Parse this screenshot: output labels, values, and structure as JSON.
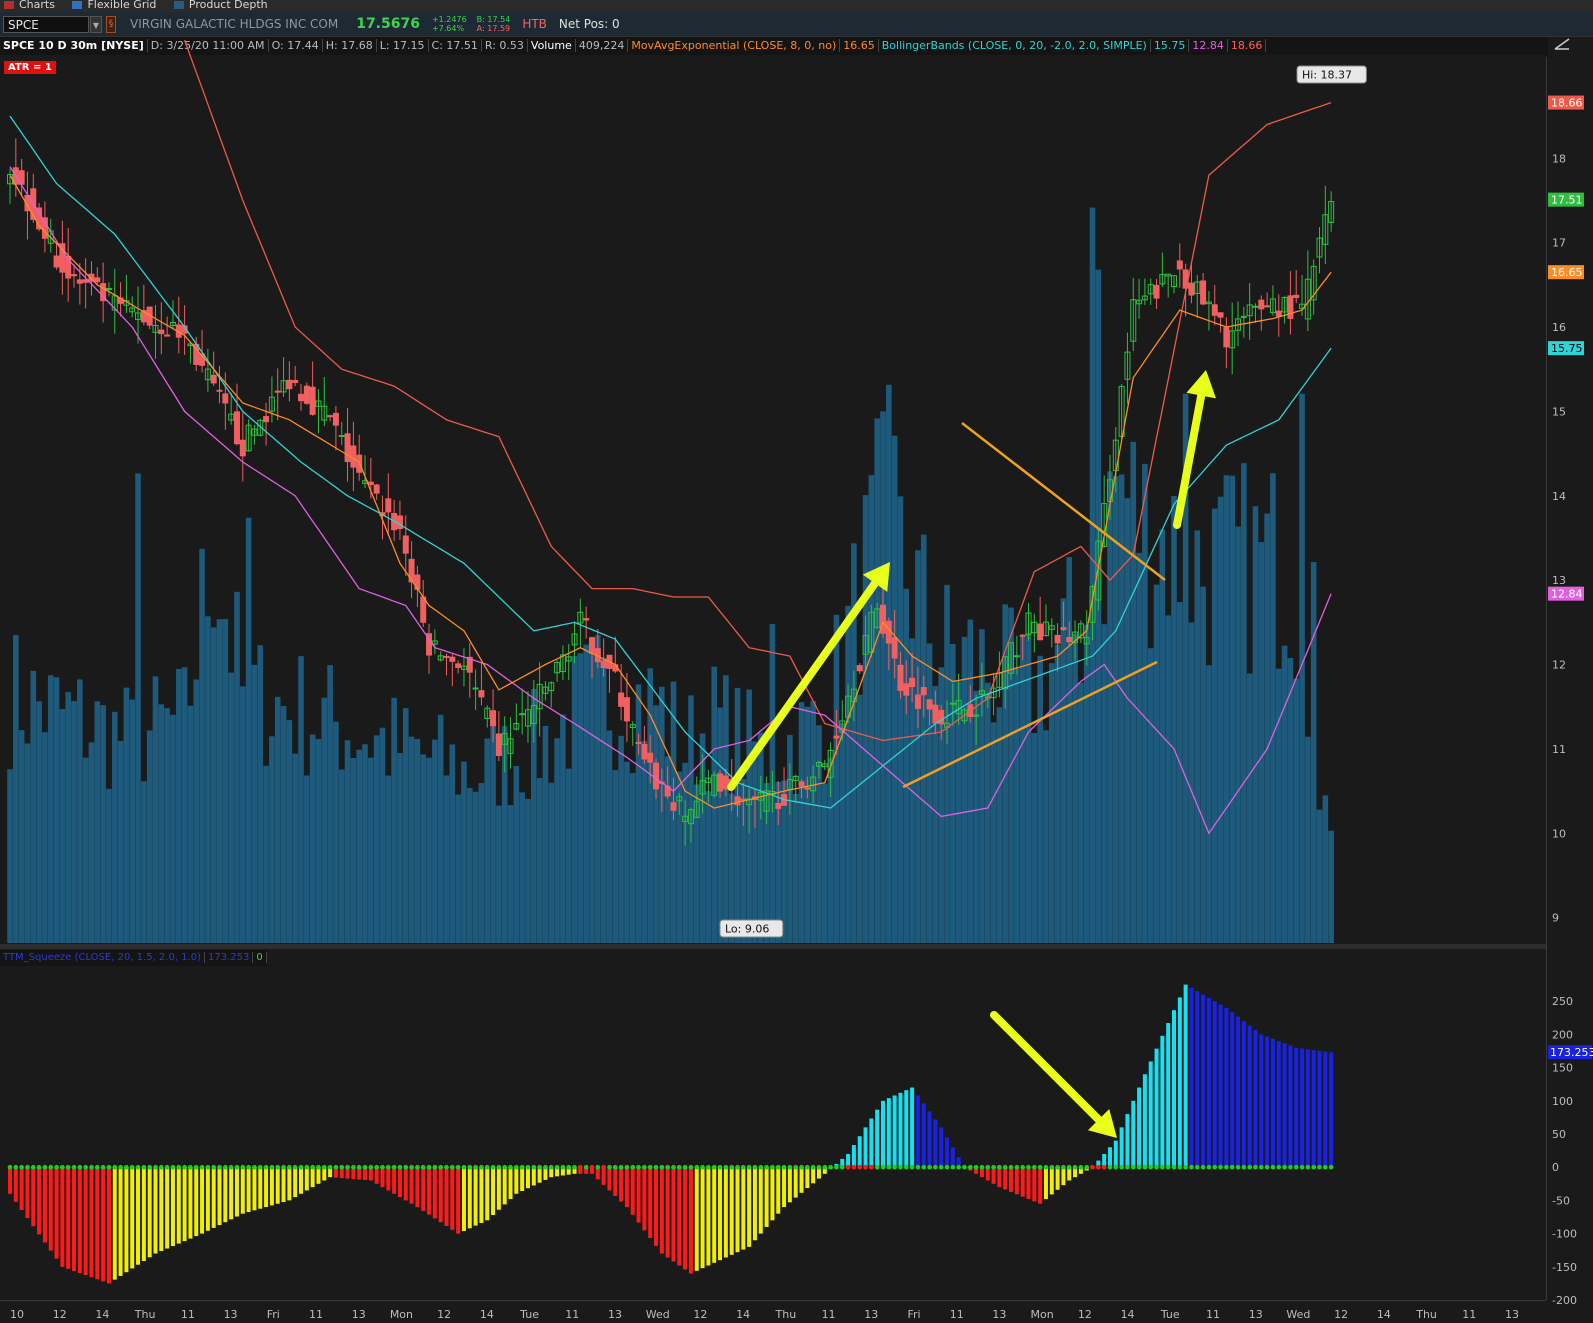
{
  "tabs": [
    {
      "label": "Charts",
      "icon": "chart-icon"
    },
    {
      "label": "Flexible Grid",
      "icon": "grid-icon"
    },
    {
      "label": "Product Depth",
      "icon": "depth-icon"
    }
  ],
  "toolbar": {
    "symbol": "SPCE",
    "company": "VIRGIN GALACTIC HLDGS INC COM",
    "last": "17.5676",
    "change": "+1.2476",
    "change_pct": "+7.64%",
    "bid": "B: 17.54",
    "ask": "A: 17.59",
    "htb": "HTB",
    "net_pos": "Net Pos: 0"
  },
  "header": {
    "title": "SPCE 10 D 30m [NYSE]",
    "date": "D: 3/25/20 11:00 AM",
    "open": "O: 17.44",
    "high": "H: 17.68",
    "low": "L: 17.15",
    "close": "C: 17.51",
    "range": "R: 0.53",
    "volume_label": "Volume",
    "volume_value": "409,224",
    "ema_label": "MovAvgExponential (CLOSE, 8, 0, no)",
    "ema_value": "16.65",
    "bb_label": "BollingerBands (CLOSE, 0, 20, -2.0, 2.0, SIMPLE)",
    "bb_mid": "15.75",
    "bb_low": "12.84",
    "bb_up": "18.66"
  },
  "atr_badge": "ATR = 1",
  "lower_header": {
    "label": "TTM_Squeeze (CLOSE, 20, 1.5, 2.0, 1.0)",
    "value": "173.253",
    "alert": "0"
  },
  "colors": {
    "up": "#2fbf3f",
    "down": "#f06060",
    "volume": "#1d5a7c",
    "ema": "#ff8c24",
    "bb_mid": "#2fd4d4",
    "bb_lower": "#e060e0",
    "bb_upper": "#ee5a4a",
    "sq_pos_up": "#18e0f0",
    "sq_pos_down": "#1822e0",
    "sq_neg_down": "#ff1a1a",
    "sq_neg_up": "#f0f000",
    "arrow": "#e8ff1a",
    "trendline": "#f0a020"
  },
  "chart_data": {
    "type": "candlestick",
    "title": "SPCE 10 D 30m [NYSE]",
    "ylim": [
      8.7,
      19.2
    ],
    "yticks": [
      9,
      10,
      11,
      12,
      13,
      14,
      15,
      16,
      17,
      18
    ],
    "xticks": [
      "10",
      "12",
      "14",
      "Thu",
      "11",
      "13",
      "Fri",
      "11",
      "13",
      "Mon",
      "12",
      "14",
      "Tue",
      "11",
      "13",
      "Wed",
      "12",
      "14",
      "Thu",
      "11",
      "13",
      "Fri",
      "11",
      "13",
      "Mon",
      "12",
      "14",
      "Tue",
      "11",
      "13",
      "Wed",
      "12",
      "14",
      "Thu",
      "11",
      "13"
    ],
    "price_badges": {
      "bb_upper": "18.66",
      "last": "17.51",
      "ema": "16.65",
      "bb_mid": "15.75",
      "bb_lower": "12.84"
    },
    "hi_label": "Hi: 18.37",
    "lo_label": "Lo: 9.06",
    "close_path": [
      [
        0,
        17.9
      ],
      [
        10,
        16.6
      ],
      [
        20,
        16.2
      ],
      [
        30,
        15.9
      ],
      [
        40,
        14.6
      ],
      [
        48,
        15.4
      ],
      [
        55,
        14.9
      ],
      [
        60,
        14.2
      ],
      [
        67,
        13.6
      ],
      [
        72,
        12.2
      ],
      [
        78,
        12.0
      ],
      [
        84,
        11.0
      ],
      [
        93,
        11.8
      ],
      [
        98,
        12.5
      ],
      [
        104,
        11.8
      ],
      [
        109,
        10.8
      ],
      [
        116,
        10.2
      ],
      [
        121,
        10.7
      ],
      [
        127,
        10.3
      ],
      [
        134,
        10.5
      ],
      [
        140,
        10.8
      ],
      [
        149,
        12.7
      ],
      [
        153,
        11.8
      ],
      [
        160,
        11.4
      ],
      [
        168,
        11.6
      ],
      [
        175,
        12.5
      ],
      [
        180,
        12.3
      ],
      [
        185,
        12.4
      ],
      [
        193,
        16.2
      ],
      [
        201,
        16.7
      ],
      [
        209,
        15.9
      ],
      [
        216,
        16.3
      ],
      [
        222,
        16.2
      ],
      [
        227,
        17.5
      ]
    ],
    "volume_path": [
      [
        0,
        0.28
      ],
      [
        20,
        0.23
      ],
      [
        30,
        0.25
      ],
      [
        35,
        0.45
      ],
      [
        40,
        0.28
      ],
      [
        55,
        0.25
      ],
      [
        67,
        0.22
      ],
      [
        80,
        0.19
      ],
      [
        93,
        0.23
      ],
      [
        100,
        0.28
      ],
      [
        111,
        0.27
      ],
      [
        116,
        0.22
      ],
      [
        121,
        0.25
      ],
      [
        130,
        0.21
      ],
      [
        140,
        0.25
      ],
      [
        150,
        0.48
      ],
      [
        160,
        0.33
      ],
      [
        165,
        0.32
      ],
      [
        175,
        0.28
      ],
      [
        186,
        0.38
      ],
      [
        190,
        0.52
      ],
      [
        195,
        0.47
      ],
      [
        205,
        0.42
      ],
      [
        220,
        0.43
      ],
      [
        224,
        0.27
      ],
      [
        227,
        0.1
      ]
    ],
    "volume_spikes": [
      [
        22,
        0.53
      ],
      [
        41,
        0.48
      ],
      [
        131,
        0.36
      ],
      [
        150,
        0.6
      ],
      [
        151,
        0.63
      ],
      [
        186,
        0.83
      ],
      [
        187,
        0.76
      ],
      [
        202,
        0.62
      ],
      [
        222,
        0.62
      ],
      [
        224,
        0.43
      ]
    ],
    "ema_path": [
      [
        0,
        17.8
      ],
      [
        5,
        17.2
      ],
      [
        15,
        16.5
      ],
      [
        30,
        15.9
      ],
      [
        40,
        15.1
      ],
      [
        48,
        14.9
      ],
      [
        60,
        14.4
      ],
      [
        67,
        13.2
      ],
      [
        72,
        12.7
      ],
      [
        78,
        12.4
      ],
      [
        84,
        11.7
      ],
      [
        92,
        12.0
      ],
      [
        98,
        12.2
      ],
      [
        104,
        12.0
      ],
      [
        110,
        11.4
      ],
      [
        116,
        10.5
      ],
      [
        121,
        10.3
      ],
      [
        127,
        10.4
      ],
      [
        133,
        10.5
      ],
      [
        140,
        10.6
      ],
      [
        150,
        12.5
      ],
      [
        155,
        12.1
      ],
      [
        162,
        11.8
      ],
      [
        170,
        11.9
      ],
      [
        180,
        12.1
      ],
      [
        185,
        12.4
      ],
      [
        193,
        15.4
      ],
      [
        201,
        16.2
      ],
      [
        209,
        16.0
      ],
      [
        217,
        16.1
      ],
      [
        222,
        16.2
      ],
      [
        227,
        16.65
      ]
    ],
    "bb_mid_path": [
      [
        0,
        18.5
      ],
      [
        8,
        17.7
      ],
      [
        18,
        17.1
      ],
      [
        30,
        16.0
      ],
      [
        40,
        15.0
      ],
      [
        50,
        14.4
      ],
      [
        58,
        14.0
      ],
      [
        66,
        13.7
      ],
      [
        78,
        13.2
      ],
      [
        90,
        12.4
      ],
      [
        97,
        12.5
      ],
      [
        104,
        12.3
      ],
      [
        116,
        11.2
      ],
      [
        125,
        10.6
      ],
      [
        133,
        10.4
      ],
      [
        141,
        10.3
      ],
      [
        150,
        10.8
      ],
      [
        159,
        11.3
      ],
      [
        166,
        11.6
      ],
      [
        178,
        11.9
      ],
      [
        186,
        12.1
      ],
      [
        190,
        12.4
      ],
      [
        200,
        13.9
      ],
      [
        209,
        14.6
      ],
      [
        218,
        14.9
      ],
      [
        227,
        15.75
      ]
    ],
    "bb_upper_path": [
      [
        30,
        19.4
      ],
      [
        40,
        17.5
      ],
      [
        49,
        16.0
      ],
      [
        57,
        15.5
      ],
      [
        66,
        15.3
      ],
      [
        75,
        14.9
      ],
      [
        84,
        14.7
      ],
      [
        93,
        13.4
      ],
      [
        100,
        12.9
      ],
      [
        107,
        12.9
      ],
      [
        114,
        12.8
      ],
      [
        120,
        12.8
      ],
      [
        127,
        12.2
      ],
      [
        134,
        12.1
      ],
      [
        140,
        11.3
      ],
      [
        150,
        11.1
      ],
      [
        160,
        11.2
      ],
      [
        168,
        11.6
      ],
      [
        176,
        13.1
      ],
      [
        184,
        13.4
      ],
      [
        189,
        13.0
      ],
      [
        193,
        13.3
      ],
      [
        206,
        17.8
      ],
      [
        216,
        18.4
      ],
      [
        227,
        18.66
      ]
    ],
    "bb_lower_path": [
      [
        0,
        17.9
      ],
      [
        10,
        16.8
      ],
      [
        21,
        16.0
      ],
      [
        30,
        15.0
      ],
      [
        40,
        14.4
      ],
      [
        49,
        14.0
      ],
      [
        55,
        13.4
      ],
      [
        60,
        12.9
      ],
      [
        68,
        12.7
      ],
      [
        73,
        12.2
      ],
      [
        82,
        12.0
      ],
      [
        90,
        11.6
      ],
      [
        97,
        11.3
      ],
      [
        106,
        10.9
      ],
      [
        114,
        10.5
      ],
      [
        121,
        11.0
      ],
      [
        127,
        11.1
      ],
      [
        134,
        11.5
      ],
      [
        140,
        11.4
      ],
      [
        150,
        10.8
      ],
      [
        160,
        10.2
      ],
      [
        168,
        10.3
      ],
      [
        175,
        11.2
      ],
      [
        184,
        11.8
      ],
      [
        188,
        12.0
      ],
      [
        192,
        11.6
      ],
      [
        200,
        11.0
      ],
      [
        206,
        10.0
      ],
      [
        216,
        11.0
      ],
      [
        227,
        12.84
      ]
    ],
    "squeeze_path": [
      [
        0,
        -40
      ],
      [
        9,
        -150
      ],
      [
        17,
        -175
      ],
      [
        25,
        -130
      ],
      [
        33,
        -100
      ],
      [
        40,
        -70
      ],
      [
        48,
        -50
      ],
      [
        55,
        -15
      ],
      [
        62,
        -20
      ],
      [
        70,
        -60
      ],
      [
        77,
        -100
      ],
      [
        82,
        -80
      ],
      [
        87,
        -40
      ],
      [
        93,
        -15
      ],
      [
        97,
        -10
      ],
      [
        100,
        -10
      ],
      [
        106,
        -60
      ],
      [
        112,
        -130
      ],
      [
        117,
        -160
      ],
      [
        122,
        -140
      ],
      [
        127,
        -120
      ],
      [
        133,
        -60
      ],
      [
        140,
        -10
      ],
      [
        144,
        20
      ],
      [
        150,
        100
      ],
      [
        155,
        120
      ],
      [
        160,
        60
      ],
      [
        164,
        0
      ],
      [
        170,
        -30
      ],
      [
        177,
        -55
      ],
      [
        182,
        -20
      ],
      [
        186,
        0
      ],
      [
        190,
        40
      ],
      [
        195,
        140
      ],
      [
        202,
        275
      ],
      [
        209,
        240
      ],
      [
        215,
        200
      ],
      [
        221,
        180
      ],
      [
        227,
        173
      ]
    ],
    "squeeze_value": 173.253,
    "squeeze_ylim": [
      -200,
      300
    ],
    "squeeze_yticks": [
      -200,
      -150,
      -100,
      -50,
      0,
      50,
      100,
      150,
      200,
      250
    ]
  }
}
